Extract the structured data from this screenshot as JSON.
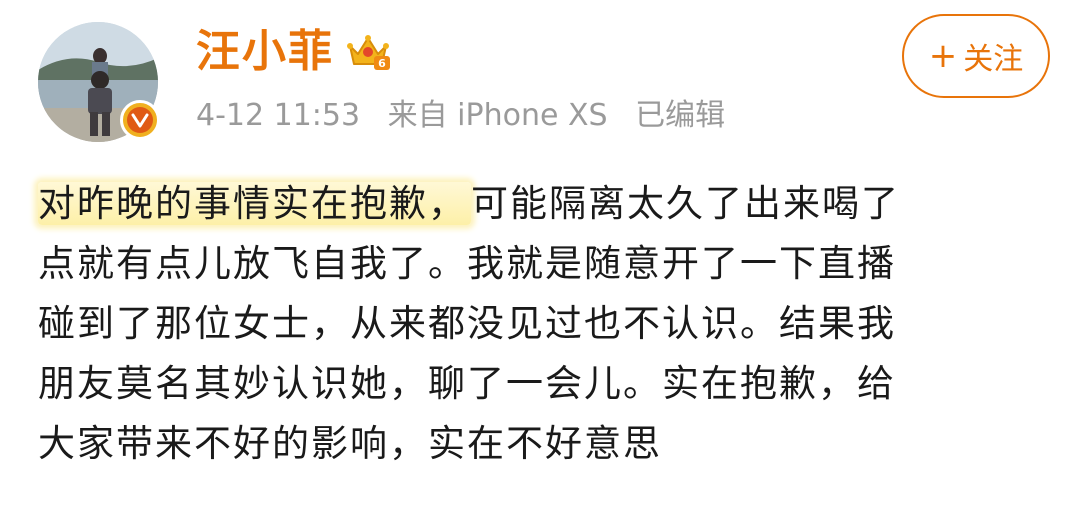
{
  "post": {
    "username": "汪小菲",
    "vip_level": "6",
    "timestamp": "4-12 11:53",
    "source": "来自 iPhone XS",
    "edited": "已编辑",
    "follow_label": "关注",
    "follow_plus": "+",
    "body": {
      "highlight": "对昨晚的事情实在抱歉，",
      "line1_rest": "可能隔离太久了出来喝了",
      "line2": "点就有点儿放飞自我了。我就是随意开了一下直播",
      "line3": "碰到了那位女士，从来都没见过也不认识。结果我",
      "line4": "朋友莫名其妙认识她，聊了一会儿。实在抱歉，给",
      "line5": "大家带来不好的影响，实在不好意思"
    }
  },
  "colors": {
    "accent": "#e8740a",
    "meta_text": "#9a9a9a",
    "body_text": "#1a1a1a",
    "highlight": "#fdf0a8",
    "verified": "#f0b020"
  },
  "icons": {
    "avatar": "user-avatar-photo",
    "verified": "verified-v-icon",
    "vip": "vip-crown-icon"
  }
}
